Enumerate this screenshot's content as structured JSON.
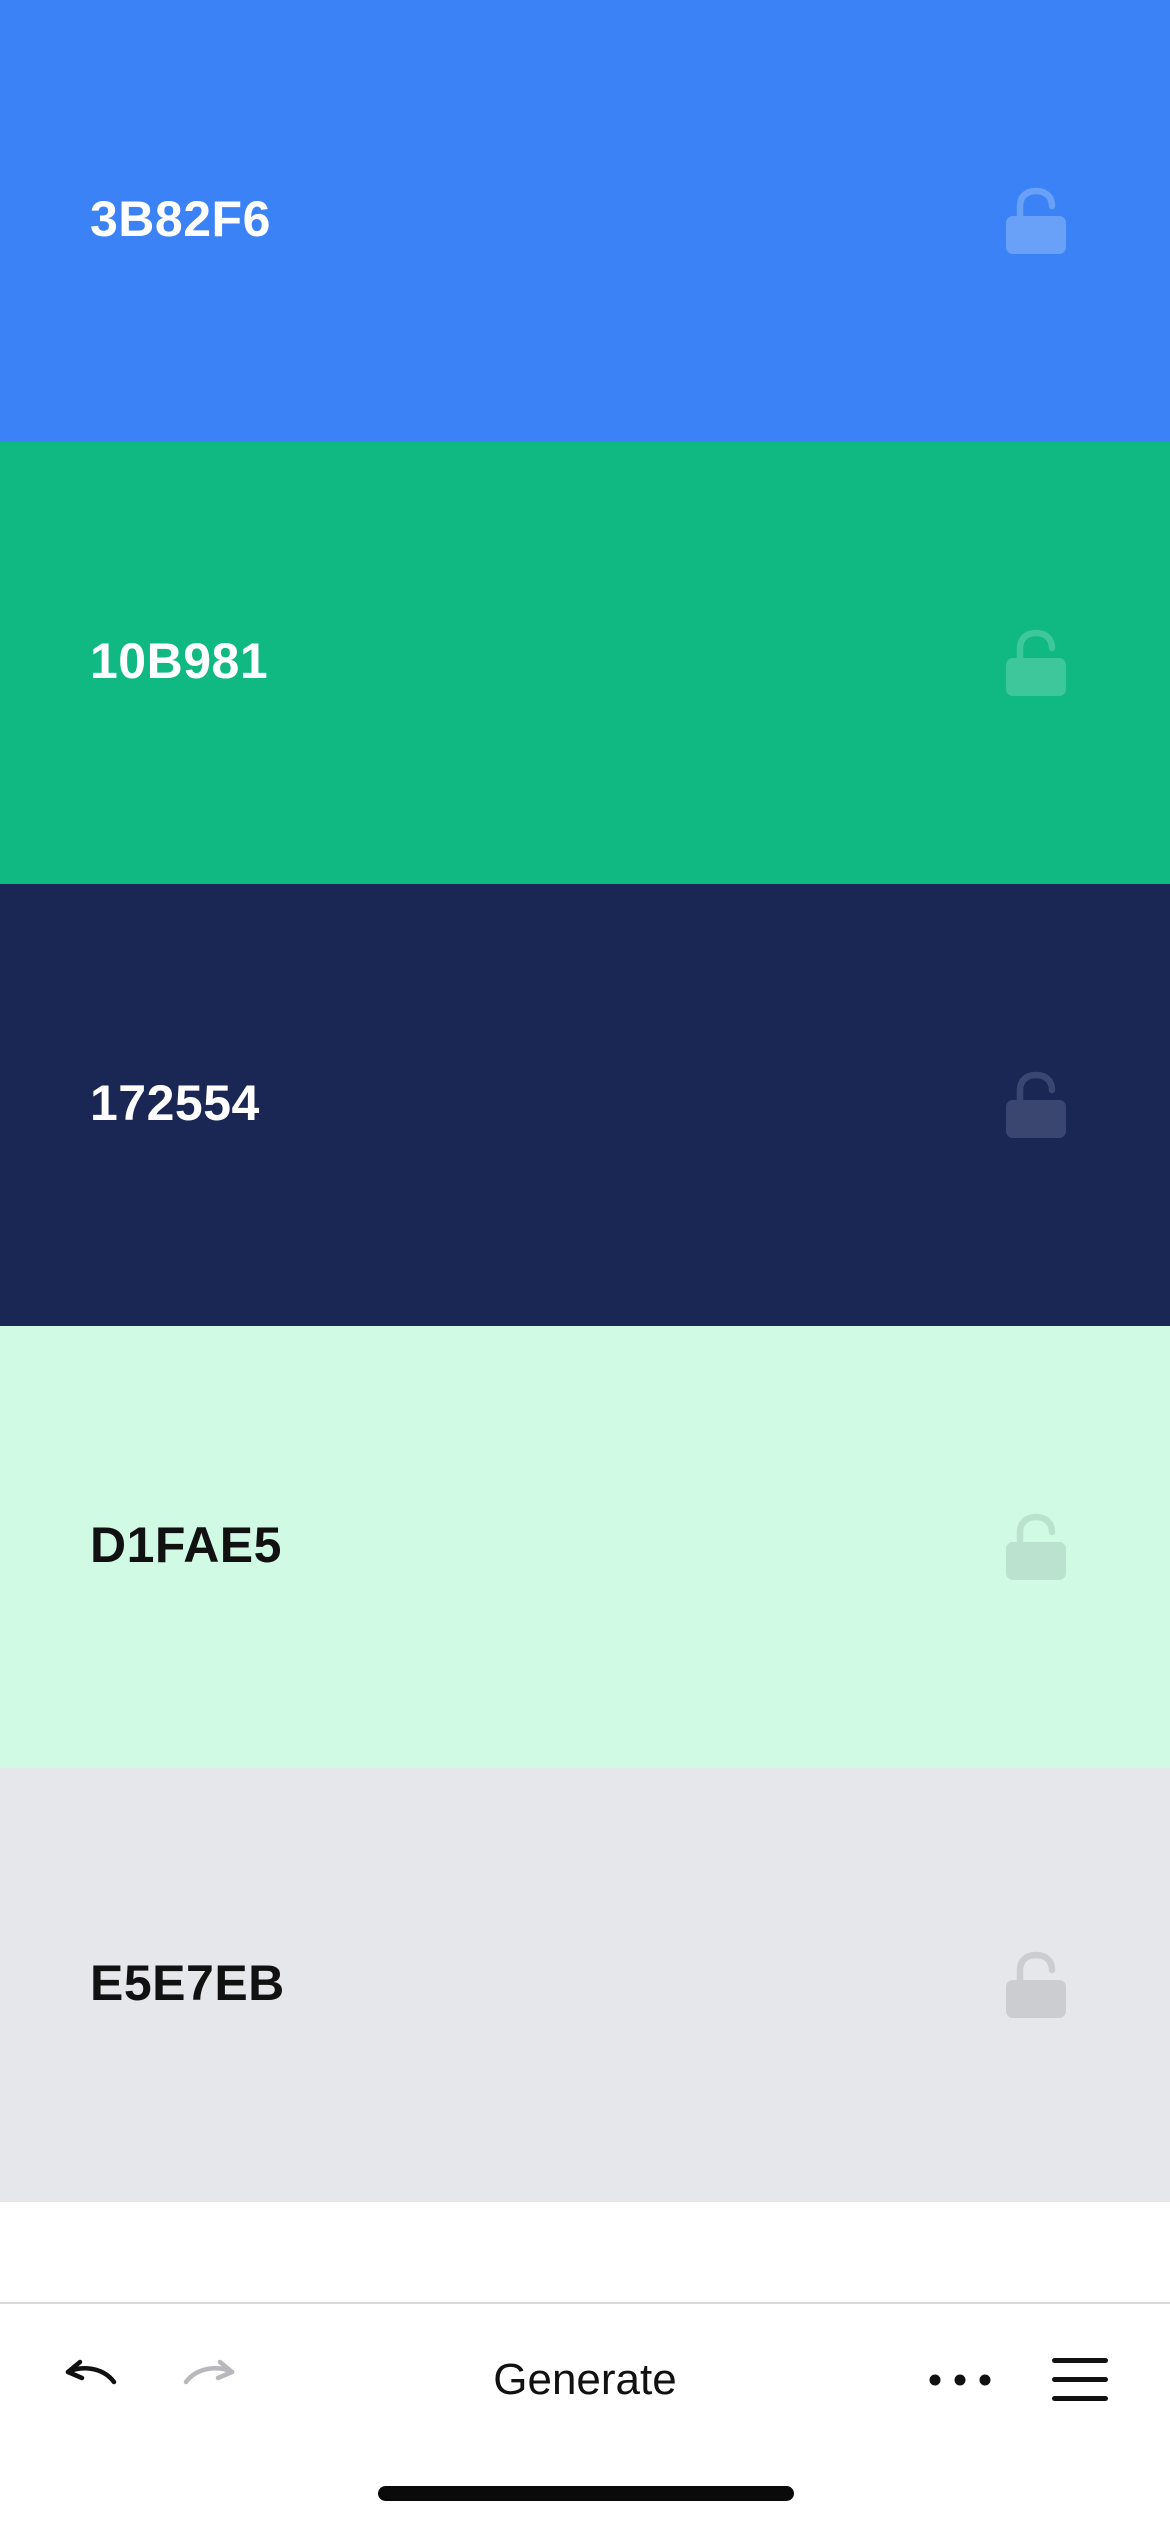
{
  "palette": {
    "colors": [
      {
        "hex": "3B82F6",
        "background": "#3B82F6",
        "text_color": "#FFFFFF",
        "locked": false,
        "lock_icon": "lock-open-icon",
        "lock_color": "#6AA1F8"
      },
      {
        "hex": "10B981",
        "background": "#10B981",
        "text_color": "#FFFFFF",
        "locked": false,
        "lock_icon": "lock-open-icon",
        "lock_color": "#3EC79A"
      },
      {
        "hex": "172554",
        "background": "#1A2754",
        "text_color": "#FFFFFF",
        "locked": false,
        "lock_icon": "lock-open-icon",
        "lock_color": "#3B4670"
      },
      {
        "hex": "D1FAE5",
        "background": "#D1FAE5",
        "text_color": "#111111",
        "locked": false,
        "lock_icon": "lock-open-icon",
        "lock_color": "#BBE2CE"
      },
      {
        "hex": "E5E7EB",
        "background": "#E5E7EB",
        "text_color": "#111111",
        "locked": false,
        "lock_icon": "lock-open-icon",
        "lock_color": "#CBCDD1"
      }
    ]
  },
  "toolbar": {
    "undo_icon": "undo-icon",
    "undo_enabled": true,
    "redo_icon": "redo-icon",
    "redo_enabled": false,
    "generate_label": "Generate",
    "more_icon": "more-horizontal-icon",
    "menu_icon": "hamburger-menu-icon"
  }
}
